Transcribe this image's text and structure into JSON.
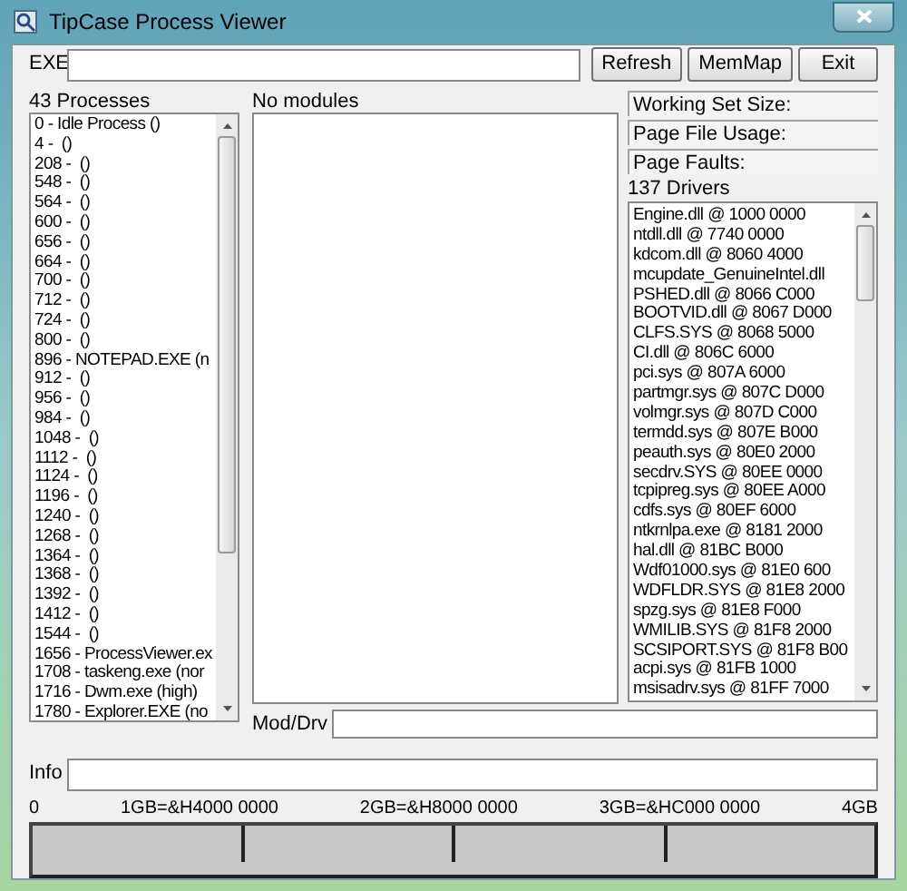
{
  "window": {
    "title": "TipCase Process Viewer"
  },
  "exe_label": "EXE",
  "buttons": [
    "Refresh",
    "MemMap",
    "Exit"
  ],
  "processes": {
    "heading": "43 Processes",
    "items": [
      "0 - Idle Process ()",
      "4 -  ()",
      "208 -  ()",
      "548 -  ()",
      "564 -  ()",
      "600 -  ()",
      "656 -  ()",
      "664 -  ()",
      "700 -  ()",
      "712 -  ()",
      "724 -  ()",
      "800 -  ()",
      "896 - NOTEPAD.EXE (n",
      "912 -  ()",
      "956 -  ()",
      "984 -  ()",
      "1048 -  ()",
      "1112 -  ()",
      "1124 -  ()",
      "1196 -  ()",
      "1240 -  ()",
      "1268 -  ()",
      "1364 -  ()",
      "1368 -  ()",
      "1392 -  ()",
      "1412 -  ()",
      "1544 -  ()",
      "1656 - ProcessViewer.ex",
      "1708 - taskeng.exe (nor",
      "1716 - Dwm.exe (high)",
      "1780 - Explorer.EXE (no"
    ]
  },
  "modules": {
    "heading": "No modules"
  },
  "stats": [
    "Working Set Size:",
    "Page File Usage:",
    "Page Faults:"
  ],
  "drivers": {
    "heading": "137 Drivers",
    "items": [
      "Engine.dll @ 1000 0000",
      "ntdll.dll @ 7740 0000",
      "kdcom.dll @ 8060 4000",
      "mcupdate_GenuineIntel.dll",
      "PSHED.dll @ 8066 C000",
      "BOOTVID.dll @ 8067 D000",
      "CLFS.SYS @ 8068 5000",
      "CI.dll @ 806C 6000",
      "pci.sys @ 807A 6000",
      "partmgr.sys @ 807C D000",
      "volmgr.sys @ 807D C000",
      "termdd.sys @ 807E B000",
      "peauth.sys @ 80E0 2000",
      "secdrv.SYS @ 80EE 0000",
      "tcpipreg.sys @ 80EE A000",
      "cdfs.sys @ 80EF 6000",
      "ntkrnlpa.exe @ 8181 2000",
      "hal.dll @ 81BC B000",
      "Wdf01000.sys @ 81E0 600",
      "WDFLDR.SYS @ 81E8 2000",
      "spzg.sys @ 81E8 F000",
      "WMILIB.SYS @ 81F8 2000",
      "SCSIPORT.SYS @ 81F8 B00",
      "acpi.sys @ 81FB 1000",
      "msisadrv.sys @ 81FF 7000"
    ]
  },
  "mod_drv_label": "Mod/Drv",
  "info_label": "Info",
  "memory_map": {
    "labels": [
      "0",
      "1GB=&H4000 0000",
      "2GB=&H8000 0000",
      "3GB=&HC000 0000",
      "4GB"
    ]
  }
}
